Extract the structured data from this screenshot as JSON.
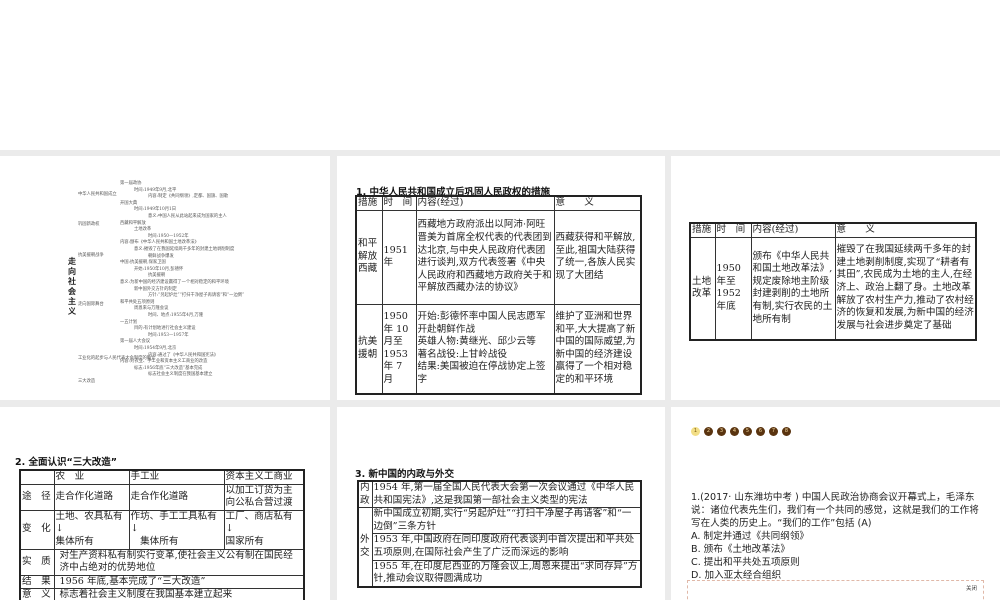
{
  "slide1": {
    "title": "走向社会主义",
    "branches": [
      "中华人民共和国成立",
      "巩固新政权",
      "抗美援朝战争",
      "走向国际舞台",
      "工业化的起步与人民代表大会制度的确立",
      "三大改造"
    ],
    "details": [
      "第一届政协",
      "时间:1949年9月,北平",
      "内容:制定《共同纲领》,定都、国旗、国歌",
      "开国大典",
      "时间:1949年10月1日",
      "意义:中国人民从此站起来成为国家的主人",
      "西藏和平解放",
      "土地改革",
      "时间:1950—1952年",
      "内容:颁布《中华人民共和国土地改革法》",
      "意义:摧毁了在我国延续两千多年的封建土地剥削制度",
      "朝鲜战争爆发",
      "中国:抗美援朝,保家卫国",
      "开始:1950年10月,彭德怀",
      "抗美援朝",
      "意义:为新中国的经济建设赢得了一个相对稳定的和平环境",
      "新中国外交方针的制定",
      "方针:“另起炉灶”“打扫干净屋子再请客”和“一边倒”",
      "和平共处五项原则",
      "周恩来与万隆会议",
      "时间、地点:1955年4月,万隆",
      "一五计划",
      "目的:有计划地进行社会主义建设",
      "时间:1953—1957年",
      "第一届人大会议",
      "时间:1954年9月,北京",
      "内容:通过了《中华人民共和国宪法》",
      "内容:对农业、手工业和资本主义工商业的改造",
      "标志:1956年底“三大改造”基本完成",
      "标志社会主义制度在我国基本建立"
    ]
  },
  "slide2": {
    "heading": "1. 中华人民共和国成立后巩固人民政权的措施",
    "headers": [
      "措施",
      "时　间",
      "内容(经过)",
      "意　　义"
    ],
    "rows": [
      {
        "measure": "和平解放西藏",
        "time": "1951 年",
        "content": "西藏地方政府派出以阿沛·阿旺晋美为首席全权代表的代表团到达北京,与中央人民政府代表团进行谈判,双方代表签署《中央人民政府和西藏地方政府关于和平解放西藏办法的协议》",
        "meaning": "西藏获得和平解放,至此,祖国大陆获得了统一,各族人民实现了大团结"
      },
      {
        "measure": "抗美援朝",
        "time": "1950 年 10 月至 1953 年 7 月",
        "content": "开始:彭德怀率中国人民志愿军开赴朝鲜作战\n英雄人物:黄继光、邱少云等\n著名战役:上甘岭战役\n结果:美国被迫在停战协定上签字",
        "meaning": "维护了亚洲和世界和平,大大提高了新中国的国际威望,为新中国的经济建设赢得了一个相对稳定的和平环境"
      }
    ]
  },
  "slide3": {
    "headers": [
      "措施",
      "时　间",
      "内容(经过)",
      "意　　义"
    ],
    "row": {
      "measure": "土地改革",
      "time": "1950 年至 1952 年底",
      "content": "颁布《中华人民共和国土地改革法》,规定废除地主阶级封建剥削的土地所有制,实行农民的土地所有制",
      "meaning": "摧毁了在我国延续两千多年的封建土地剥削制度,实现了“耕者有其田”,农民成为土地的主人,在经济上、政治上翻了身。土地改革解放了农村生产力,推动了农村经济的恢复和发展,为新中国的经济发展与社会进步奠定了基础"
    }
  },
  "slide4": {
    "heading": "2. 全面认识“三大改造”",
    "headers": [
      "",
      "农　业",
      "手工业",
      "资本主义工商业"
    ],
    "rows": [
      {
        "label": "途　径",
        "cells": [
          "走合作化道路",
          "走合作化道路",
          "以加工订货为主向公私合营过渡"
        ]
      },
      {
        "label": "变　化",
        "cells": [
          "土地、农具私有\n↓\n集体所有",
          "作坊、手工工具私有\n↓\n　集体所有",
          "工厂、商店私有\n↓\n国家所有"
        ]
      }
    ],
    "essence_label": "实　质",
    "essence": "对生产资料私有制实行变革,使社会主义公有制在国民经济中占绝对的优势地位",
    "result_label": "结　果",
    "result": "1956 年底,基本完成了“三大改造”",
    "meaning_label": "意　义",
    "meaning": "标志着社会主义制度在我国基本建立起来"
  },
  "slide5": {
    "heading": "3. 新中国的内政与外交",
    "domestic_label": "内政",
    "domestic": "1954 年,第一届全国人民代表大会第一次会议通过《中华人民共和国宪法》,这是我国第一部社会主义类型的宪法",
    "foreign_label": "外交",
    "foreign": [
      "新中国成立初期,实行“另起炉灶”“打扫干净屋子再请客”和“一边倒”三条方针",
      "1953 年,中国政府在同印度政府代表谈判中首次提出和平共处五项原则,在国际社会产生了广泛而深远的影响",
      "1955 年,在印度尼西亚的万隆会议上,周恩来提出“求同存异”方针,推动会议取得圆满成功"
    ]
  },
  "slide6": {
    "pages": [
      "1",
      "2",
      "3",
      "4",
      "5",
      "6",
      "7",
      "8"
    ],
    "current_page": 1,
    "question": "1.(2017· 山东潍坊中考 ) 中国人民政治协商会议开幕式上，毛泽东说：诸位代表先生们，我们有一个共同的感觉，这就是我们的工作将写在人类的历史上。“我们的工作”包括 (A)",
    "options": [
      "A. 制定并通过《共同纲领》",
      "B. 颁布《土地改革法》",
      "C. 提出和平共处五项原则",
      "D. 加入亚太经合组织"
    ],
    "close_label": "关闭",
    "accent": "#5a3410"
  }
}
